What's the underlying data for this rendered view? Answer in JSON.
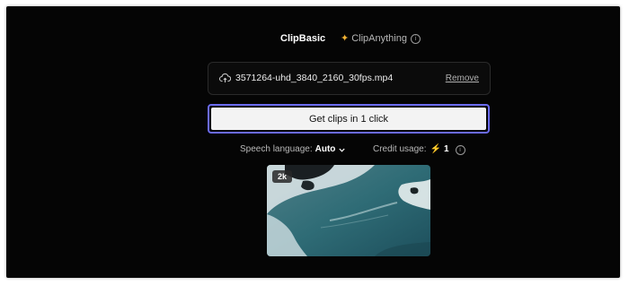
{
  "tabs": {
    "basic_label": "ClipBasic",
    "anything_label": "ClipAnything"
  },
  "file": {
    "name": "3571264-uhd_3840_2160_30fps.mp4",
    "remove_label": "Remove"
  },
  "cta_label": "Get clips in 1 click",
  "options": {
    "speech_label": "Speech language:",
    "speech_value": "Auto",
    "credit_label": "Credit usage:",
    "credit_value": "1"
  },
  "thumbnail": {
    "badge": "2k"
  },
  "colors": {
    "background": "#050505",
    "accent_border": "#6b6bf0",
    "sparkle": "#f2b233",
    "button_bg": "#f3f3f3"
  },
  "icons": [
    "upload-icon",
    "sparkle-icon",
    "info-icon",
    "chevron-down-icon",
    "bolt-icon"
  ]
}
